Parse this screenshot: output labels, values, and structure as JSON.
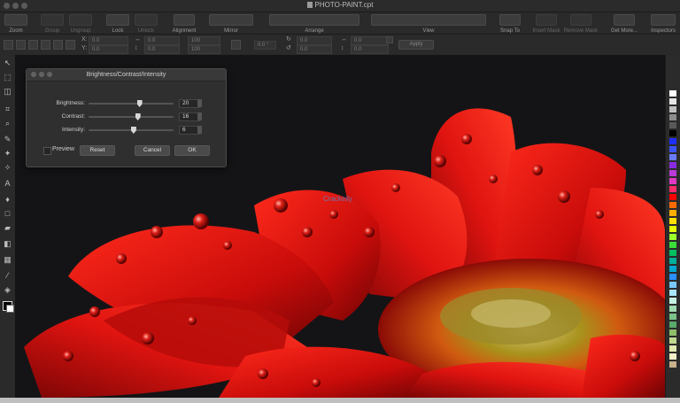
{
  "window": {
    "title": "PHOTO-PAINT.cpt"
  },
  "toolbar": {
    "items": [
      {
        "label": "Zoom",
        "icon": "zoom-icon",
        "enabled": true
      },
      {
        "label": "Group",
        "icon": "group-icon",
        "enabled": false
      },
      {
        "label": "Ungroup",
        "icon": "ungroup-icon",
        "enabled": false
      },
      {
        "label": "Lock",
        "icon": "lock-icon",
        "enabled": true
      },
      {
        "label": "Unlock",
        "icon": "unlock-icon",
        "enabled": false
      },
      {
        "label": "Alignment",
        "icon": "alignment-icon",
        "enabled": true
      },
      {
        "label": "Mirror",
        "icon": "mirror-icon",
        "enabled": true
      },
      {
        "label": "Arrange",
        "icon": "arrange-icon",
        "enabled": true
      },
      {
        "label": "View",
        "icon": "view-icon",
        "enabled": true
      },
      {
        "label": "Snap To",
        "icon": "snap-icon",
        "enabled": true
      },
      {
        "label": "Insert Mask",
        "icon": "insert-mask-icon",
        "enabled": false
      },
      {
        "label": "Remove Mask",
        "icon": "remove-mask-icon",
        "enabled": false
      },
      {
        "label": "Get More...",
        "icon": "get-more-icon",
        "enabled": true
      },
      {
        "label": "Inspectors",
        "icon": "inspectors-icon",
        "enabled": true
      }
    ]
  },
  "propbar": {
    "x": "0.0",
    "y": "0.0",
    "x2": "0.0",
    "y2": "0.0",
    "w": "100",
    "h": "100",
    "angle": "0.0 °",
    "r1": "0.0",
    "r2": "0.0",
    "r3": "0.0",
    "r4": "0.0",
    "x_label": "X:",
    "y_label": "Y:",
    "apply": "Apply"
  },
  "dialog": {
    "title": "Brightness/Contrast/Intensity",
    "brightness": {
      "label": "Brightness:",
      "value": "20",
      "fraction": 0.6
    },
    "contrast": {
      "label": "Contrast:",
      "value": "16",
      "fraction": 0.58
    },
    "intensity": {
      "label": "Intensity:",
      "value": "6",
      "fraction": 0.53
    },
    "preview_label": "Preview",
    "preview_checked": false,
    "reset": "Reset",
    "cancel": "Cancel",
    "ok": "OK"
  },
  "watermark": "Crackeily",
  "palette": [
    "#ffffff",
    "#e6e6e6",
    "#bfbfbf",
    "#8c8c8c",
    "#595959",
    "#000000",
    "#1f2fff",
    "#3a53ff",
    "#6a7bff",
    "#8a2be2",
    "#b93ad8",
    "#e03ac4",
    "#ff2a6a",
    "#ff0000",
    "#ff6a00",
    "#ffae00",
    "#ffe000",
    "#e6ff00",
    "#9aff2a",
    "#3adf3a",
    "#00c060",
    "#00b09a",
    "#00a8d0",
    "#2a8fff",
    "#78c8ff",
    "#a9e6ff",
    "#c7f0e0",
    "#a0d8b0",
    "#7ac38a",
    "#5aa86a",
    "#8fbf6a",
    "#c0d890",
    "#e0e8b0",
    "#f3f0c6",
    "#c8b08a"
  ]
}
